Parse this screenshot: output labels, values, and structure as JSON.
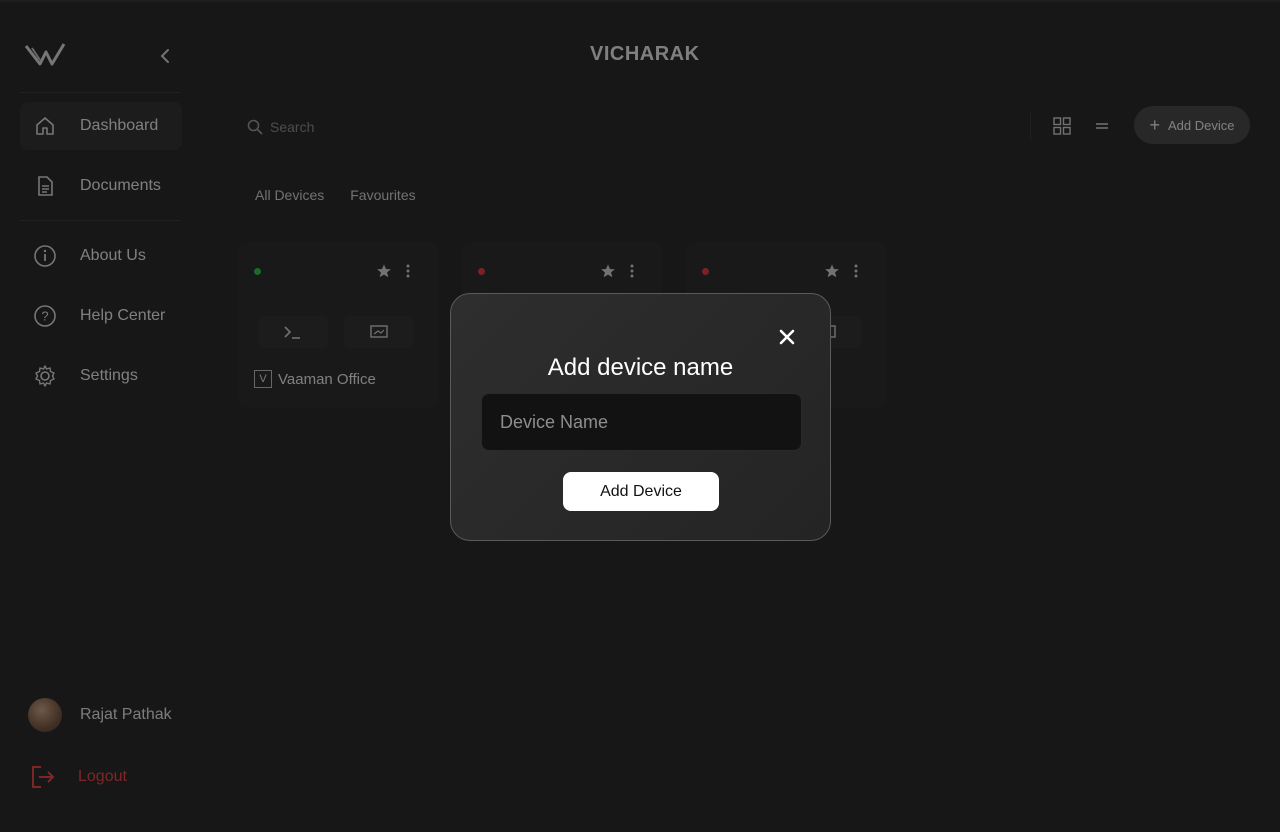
{
  "app": {
    "title": "VICHARAK"
  },
  "sidebar": {
    "items": [
      {
        "label": "Dashboard",
        "icon": "home-icon",
        "active": true
      },
      {
        "label": "Documents",
        "icon": "document-icon"
      },
      {
        "label": "About Us",
        "icon": "info-icon"
      },
      {
        "label": "Help Center",
        "icon": "help-icon"
      },
      {
        "label": "Settings",
        "icon": "gear-icon"
      }
    ],
    "user": {
      "name": "Rajat Pathak"
    },
    "logout_label": "Logout"
  },
  "toolbar": {
    "search_placeholder": "Search",
    "add_device_label": "Add Device"
  },
  "tabs": [
    "All Devices",
    "Favourites"
  ],
  "devices": [
    {
      "name": "Vaaman Office",
      "status_color": "#33c24d",
      "badge": "V"
    },
    {
      "name": "",
      "status_color": "#d94040"
    },
    {
      "name": "",
      "status_color": "#d94040"
    }
  ],
  "modal": {
    "title": "Add device name",
    "input_placeholder": "Device Name",
    "submit_label": "Add Device"
  },
  "colors": {
    "background": "#2b2b2b",
    "accent": "#ffffff",
    "danger": "#e04848",
    "online": "#33c24d"
  }
}
